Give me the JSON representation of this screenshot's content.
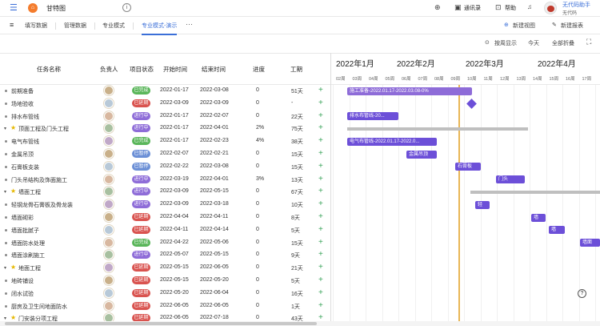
{
  "topbar": {
    "menu_icon": "☰",
    "logo_icon": "⌂",
    "app_title": "甘特图",
    "info_icon": "i",
    "plus_icon": "⊕",
    "contacts_label": "通讯录",
    "help_label": "帮助",
    "bell_icon": "🔔",
    "user_name": "无代码助手",
    "user_org": "无代码"
  },
  "tabs": {
    "hamburger_icon": "≡",
    "items": [
      "填写数据",
      "管理数据",
      "专业模式",
      "专业模式-演示"
    ],
    "more": "···",
    "add_field": "新建视图",
    "add_report": "新建报表"
  },
  "toolbar": {
    "by_week": "按周显示",
    "today": "今天",
    "collapse_all": "全部折叠"
  },
  "columns": [
    "任务名称",
    "负责人",
    "项目状态",
    "开始时间",
    "结束时间",
    "进度",
    "工期"
  ],
  "status_colors": {
    "已完成": "#5ab65a",
    "已延期": "#d9534f",
    "进行中": "#8e6cd8",
    "已暂停": "#6b8fd6",
    "未开始": "#5ab65a"
  },
  "rows": [
    {
      "name": "前期准备",
      "type": "task",
      "status": "已完成",
      "start": "2022-01-17",
      "end": "2022-03-08",
      "progress": "0",
      "duration": "51天"
    },
    {
      "name": "场地验收",
      "type": "task",
      "status": "已延期",
      "start": "2022-03-09",
      "end": "2022-03-09",
      "progress": "0",
      "duration": "-"
    },
    {
      "name": "排水布管线",
      "type": "task",
      "status": "进行中",
      "start": "2022-01-17",
      "end": "2022-02-07",
      "progress": "0",
      "duration": "22天"
    },
    {
      "name": "顶面工程及门头工程",
      "type": "group",
      "status": "进行中",
      "start": "2022-01-17",
      "end": "2022-04-01",
      "progress": "2%",
      "duration": "75天"
    },
    {
      "name": "电气布管线",
      "type": "task",
      "status": "已完成",
      "start": "2022-01-17",
      "end": "2022-02-23",
      "progress": "4%",
      "duration": "38天"
    },
    {
      "name": "金属吊顶",
      "type": "task",
      "status": "已暂停",
      "start": "2022-02-07",
      "end": "2022-02-21",
      "progress": "0",
      "duration": "15天"
    },
    {
      "name": "石膏板支装",
      "type": "task",
      "status": "已暂停",
      "start": "2022-02-22",
      "end": "2022-03-08",
      "progress": "0",
      "duration": "15天"
    },
    {
      "name": "门头吊结构及饰面施工",
      "type": "task",
      "status": "进行中",
      "start": "2022-03-19",
      "end": "2022-04-01",
      "progress": "3%",
      "duration": "13天"
    },
    {
      "name": "墙面工程",
      "type": "group",
      "status": "进行中",
      "start": "2022-03-09",
      "end": "2022-05-15",
      "progress": "0",
      "duration": "67天"
    },
    {
      "name": "轻钢龙骨石膏板及骨龙装",
      "type": "task",
      "status": "进行中",
      "start": "2022-03-09",
      "end": "2022-03-18",
      "progress": "0",
      "duration": "10天"
    },
    {
      "name": "墙面砌彩",
      "type": "task",
      "status": "已延期",
      "start": "2022-04-04",
      "end": "2022-04-11",
      "progress": "0",
      "duration": "8天"
    },
    {
      "name": "墙面批腻子",
      "type": "task",
      "status": "已延期",
      "start": "2022-04-11",
      "end": "2022-04-14",
      "progress": "0",
      "duration": "5天"
    },
    {
      "name": "墙面防水处理",
      "type": "task",
      "status": "已完成",
      "start": "2022-04-22",
      "end": "2022-05-06",
      "progress": "0",
      "duration": "15天"
    },
    {
      "name": "墙面涂刷施工",
      "type": "task",
      "status": "进行中",
      "start": "2022-05-07",
      "end": "2022-05-15",
      "progress": "0",
      "duration": "9天"
    },
    {
      "name": "地面工程",
      "type": "group",
      "status": "已延期",
      "start": "2022-05-15",
      "end": "2022-06-05",
      "progress": "0",
      "duration": "21天"
    },
    {
      "name": "地砖铺设",
      "type": "task",
      "status": "已延期",
      "start": "2022-05-15",
      "end": "2022-05-20",
      "progress": "0",
      "duration": "5天"
    },
    {
      "name": "闭水试验",
      "type": "task",
      "status": "已延期",
      "start": "2022-05-20",
      "end": "2022-06-04",
      "progress": "0",
      "duration": "16天"
    },
    {
      "name": "厨房及卫生间地面防水",
      "type": "task",
      "status": "已延期",
      "start": "2022-06-05",
      "end": "2022-06-05",
      "progress": "0",
      "duration": "1天"
    },
    {
      "name": "门安装分项工程",
      "type": "group",
      "status": "已延期",
      "start": "2022-06-05",
      "end": "2022-07-18",
      "progress": "0",
      "duration": "43天"
    }
  ],
  "gantt": {
    "months": [
      "2022年1月",
      "2022年2月",
      "2022年3月",
      "2022年4月"
    ],
    "weeks": [
      "02周",
      "03周",
      "04周",
      "05周",
      "06周",
      "07周",
      "08周",
      "09周",
      "10周",
      "11周",
      "12周",
      "13周",
      "14周",
      "15周",
      "16周",
      "17周"
    ],
    "bars": [
      {
        "row": 0,
        "label": "施工准备-2022.01.17-2022.03.08-0%",
        "color": "#8e6cd8"
      },
      {
        "row": 2,
        "label": "排水布管线-20...",
        "color": "#6c4fd8"
      },
      {
        "row": 4,
        "label": "电气布管线-2022.01.17-2022.0...",
        "color": "#6c4fd8"
      },
      {
        "row": 5,
        "label": "金属吊顶",
        "color": "#6c4fd8"
      },
      {
        "row": 6,
        "label": "石膏板",
        "color": "#6c4fd8"
      },
      {
        "row": 7,
        "label": "门头",
        "color": "#6c4fd8"
      },
      {
        "row": 9,
        "label": "轻",
        "color": "#6c4fd8"
      },
      {
        "row": 10,
        "label": "墙",
        "color": "#6c4fd8"
      },
      {
        "row": 11,
        "label": "墙",
        "color": "#6c4fd8"
      },
      {
        "row": 12,
        "label": "墙面",
        "color": "#6c4fd8"
      }
    ]
  },
  "help_icon": "?"
}
